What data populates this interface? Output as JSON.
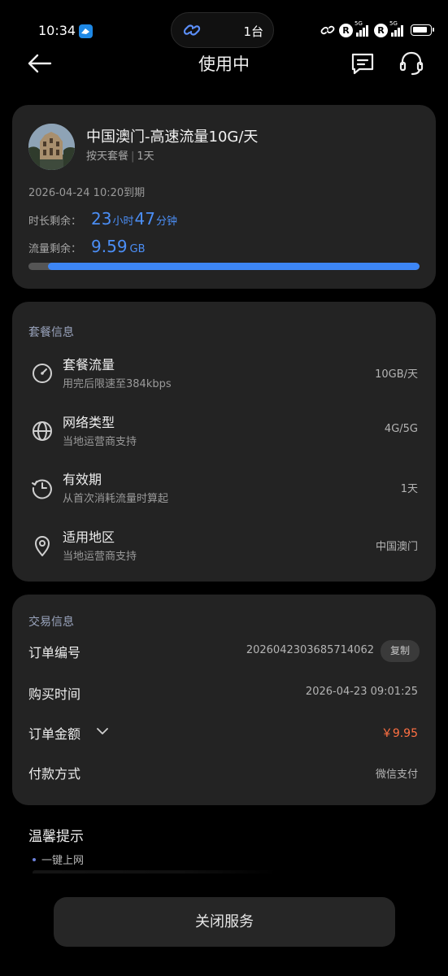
{
  "status_bar": {
    "time": "10:34",
    "island_count": "1台",
    "sim1_badge": "R",
    "sim2_badge": "R",
    "network1": "5G",
    "network2": "5G"
  },
  "header": {
    "title": "使用中"
  },
  "plan": {
    "name": "中国澳门-高速流量10G/天",
    "type": "按天套餐",
    "duration": "1天",
    "expire_text": "2026-04-24 10:20到期",
    "time_label": "时长剩余：",
    "hours": "23",
    "hours_unit": "小时",
    "minutes": "47",
    "minutes_unit": "分钟",
    "flow_label": "流量剩余：",
    "flow_value": "9.59",
    "flow_unit": "GB",
    "flow_used_fraction": 0.05
  },
  "package_info": {
    "title": "套餐信息",
    "items": [
      {
        "icon": "speedometer-icon",
        "title": "套餐流量",
        "desc": "用完后限速至384kbps",
        "value": "10GB/天"
      },
      {
        "icon": "globe-icon",
        "title": "网络类型",
        "desc": "当地运营商支持",
        "value": "4G/5G"
      },
      {
        "icon": "clock-history-icon",
        "title": "有效期",
        "desc": "从首次消耗流量时算起",
        "value": "1天"
      },
      {
        "icon": "location-pin-icon",
        "title": "适用地区",
        "desc": "当地运营商支持",
        "value": "中国澳门"
      }
    ]
  },
  "trade_info": {
    "title": "交易信息",
    "order_label": "订单编号",
    "order_no": "2026042303685714062",
    "copy_label": "复制",
    "time_label": "购买时间",
    "time_value": "2026-04-23 09:01:25",
    "amount_label": "订单金额",
    "amount_value": "￥9.95",
    "pay_label": "付款方式",
    "pay_value": "微信支付"
  },
  "tips": {
    "title": "温馨提示",
    "items": [
      "一键上网"
    ]
  },
  "bottom": {
    "close_button": "关闭服务"
  },
  "colors": {
    "accent_blue": "#4b8ef5",
    "price_orange": "#ff7043",
    "card_bg": "#232323"
  }
}
